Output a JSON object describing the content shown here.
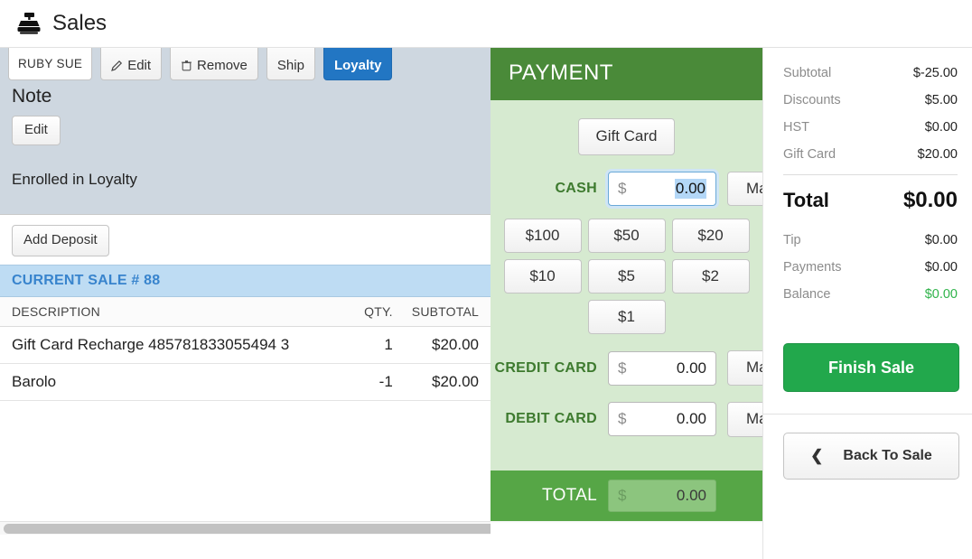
{
  "header": {
    "icon": "cash-register-icon",
    "title": "Sales"
  },
  "customer_panel": {
    "customer_name": "RUBY SUE",
    "edit_label": "Edit",
    "edit_icon": "pencil-icon",
    "remove_label": "Remove",
    "remove_icon": "trash-icon",
    "ship_label": "Ship",
    "loyalty_label": "Loyalty",
    "note_heading": "Note",
    "note_edit_label": "Edit",
    "loyalty_status": "Enrolled in Loyalty",
    "add_deposit_label": "Add Deposit"
  },
  "sale": {
    "header": "CURRENT SALE # 88",
    "columns": {
      "description": "DESCRIPTION",
      "qty": "QTY.",
      "subtotal": "SUBTOTAL"
    },
    "rows": [
      {
        "description": "Gift Card Recharge 485781833055494 3",
        "qty": "1",
        "subtotal": "$20.00"
      },
      {
        "description": "Barolo",
        "qty": "-1",
        "subtotal": "$20.00"
      }
    ]
  },
  "payment": {
    "title": "PAYMENT",
    "gift_card_label": "Gift Card",
    "cash_label": "CASH",
    "cash_value": "0.00",
    "cash_currency": "$",
    "cash_max_label": "Max",
    "denominations": [
      "$100",
      "$50",
      "$20",
      "$10",
      "$5",
      "$2",
      "$1"
    ],
    "credit_card_label": "CREDIT CARD",
    "credit_card_value": "0.00",
    "credit_card_max_label": "Max",
    "debit_card_label": "DEBIT CARD",
    "debit_card_value": "0.00",
    "debit_card_max_label": "Max",
    "total_label": "TOTAL",
    "total_value": "0.00",
    "total_currency": "$",
    "header_color": "#4a8a39",
    "body_color": "#d6ead0",
    "total_bar_color": "#56a646"
  },
  "summary": {
    "rows": [
      {
        "label": "Subtotal",
        "value": "$-25.00"
      },
      {
        "label": "Discounts",
        "value": "$5.00"
      },
      {
        "label": "HST",
        "value": "$0.00"
      },
      {
        "label": "Gift Card",
        "value": "$20.00"
      }
    ],
    "total_label": "Total",
    "total_value": "$0.00",
    "secondary_rows": [
      {
        "label": "Tip",
        "value": "$0.00"
      },
      {
        "label": "Payments",
        "value": "$0.00"
      }
    ],
    "balance_label": "Balance",
    "balance_value": "$0.00",
    "balance_color": "#2fb34a",
    "finish_sale_label": "Finish Sale",
    "back_to_sale_label": "Back To Sale",
    "back_icon": "chevron-left-icon"
  }
}
